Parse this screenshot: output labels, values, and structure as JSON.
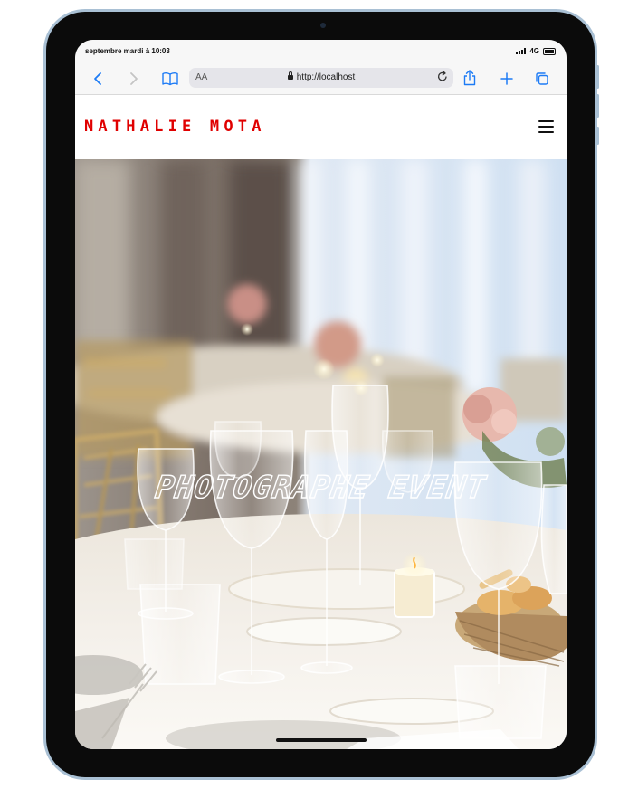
{
  "status_bar": {
    "time": "septembre mardi à 10:03",
    "network": "4G",
    "signal_icon": "signal-icon",
    "battery_icon": "battery-icon"
  },
  "browser": {
    "text_size_label": "AA",
    "url": "http://localhost",
    "back_icon": "chevron-left-icon",
    "forward_icon": "chevron-right-icon",
    "bookmarks_icon": "book-icon",
    "reload_icon": "reload-icon",
    "share_icon": "share-icon",
    "new_tab_icon": "plus-icon",
    "tabs_icon": "tabs-icon",
    "accent_color": "#1d7bf5"
  },
  "site": {
    "logo": "NATHALIE MOTA",
    "logo_color": "#e00000",
    "menu_icon": "hamburger-icon",
    "hero_title": "PHOTOGRAPHE EVENT",
    "hero_image": "Banquet table with wine glasses, candles, pink roses and bread basket"
  }
}
